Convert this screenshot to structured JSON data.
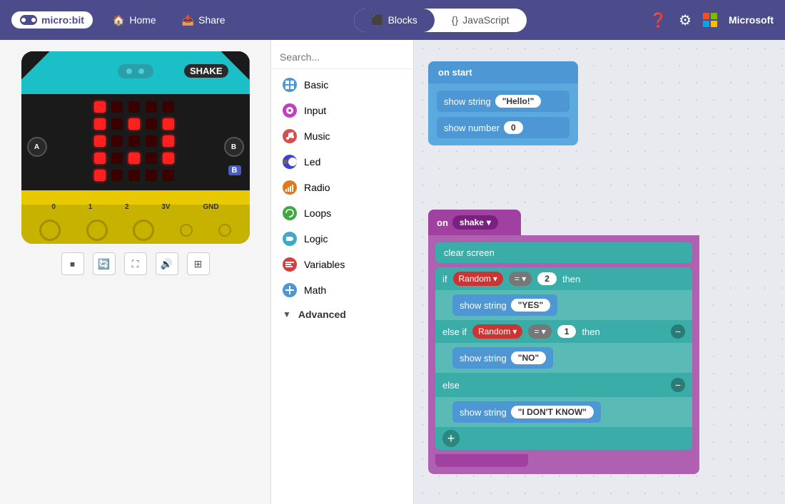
{
  "header": {
    "logo": "micro:bit",
    "nav": [
      {
        "label": "Home",
        "icon": "home"
      },
      {
        "label": "Share",
        "icon": "share"
      }
    ],
    "tabs": [
      {
        "label": "Blocks",
        "icon": "blocks",
        "active": true
      },
      {
        "label": "JavaScript",
        "icon": "js",
        "active": false
      }
    ],
    "actions": [
      {
        "label": "help",
        "icon": "?"
      },
      {
        "label": "settings",
        "icon": "⚙"
      }
    ],
    "brand": "Microsoft"
  },
  "simulator": {
    "shake_label": "SHAKE",
    "button_a": "A",
    "button_b": "B",
    "pin_labels": [
      "0",
      "1",
      "2",
      "3V",
      "GND"
    ],
    "controls": [
      "stop",
      "restart",
      "fullscreen",
      "sound",
      "expand"
    ]
  },
  "toolbox": {
    "search_placeholder": "Search...",
    "categories": [
      {
        "label": "Basic",
        "color": "#4c97d4",
        "icon": "grid"
      },
      {
        "label": "Input",
        "color": "#c040c0",
        "icon": "circle"
      },
      {
        "label": "Music",
        "color": "#d4504c",
        "icon": "music"
      },
      {
        "label": "Led",
        "color": "#5050d4",
        "icon": "toggle"
      },
      {
        "label": "Radio",
        "color": "#e07820",
        "icon": "radio"
      },
      {
        "label": "Loops",
        "color": "#40a840",
        "icon": "loop"
      },
      {
        "label": "Logic",
        "color": "#40a8c8",
        "icon": "logic"
      },
      {
        "label": "Variables",
        "color": "#d44040",
        "icon": "var"
      },
      {
        "label": "Math",
        "color": "#4c97d4",
        "icon": "math"
      },
      {
        "label": "Advanced",
        "color": "#333",
        "icon": "chevron"
      }
    ]
  },
  "workspace": {
    "on_start": {
      "header": "on start",
      "blocks": [
        {
          "type": "show_string",
          "label": "show string",
          "value": "\"Hello!\""
        },
        {
          "type": "show_number",
          "label": "show number",
          "value": "0"
        }
      ]
    },
    "on_shake": {
      "header": "on",
      "event": "shake",
      "blocks": [
        {
          "type": "clear_screen",
          "label": "clear screen"
        },
        {
          "type": "if",
          "label": "if",
          "condition_var": "Random",
          "condition_op": "=",
          "condition_val": "2",
          "then": "then",
          "then_block": {
            "label": "show string",
            "value": "\"YES\""
          }
        },
        {
          "type": "else_if",
          "label": "else if",
          "condition_var": "Random",
          "condition_op": "=",
          "condition_val": "1",
          "then": "then",
          "then_block": {
            "label": "show string",
            "value": "\"NO\""
          }
        },
        {
          "type": "else",
          "label": "else",
          "then_block": {
            "label": "show string",
            "value": "\"I DON'T KNOW\""
          }
        }
      ]
    }
  }
}
